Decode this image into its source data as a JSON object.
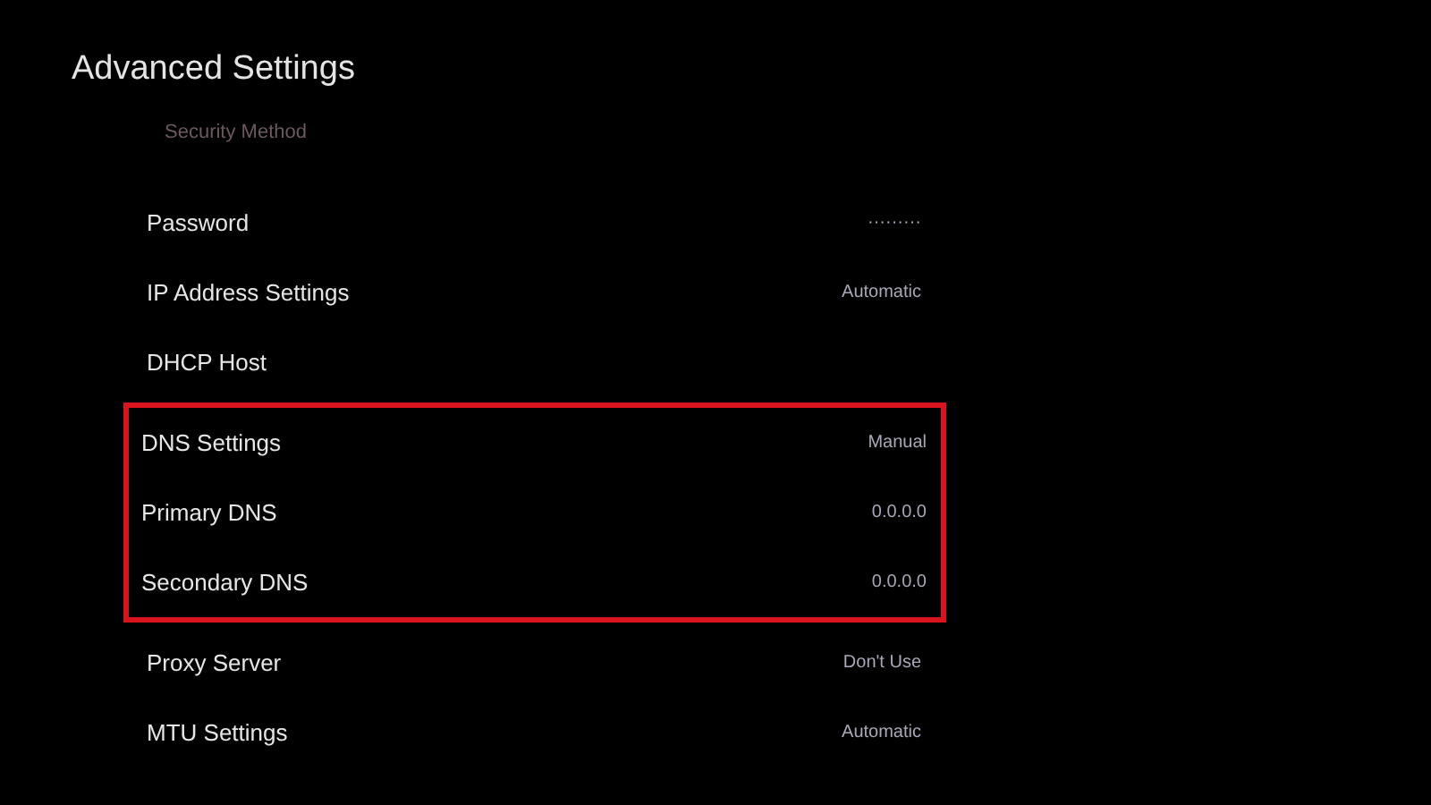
{
  "title": "Advanced Settings",
  "faded_item": "Security Method",
  "rows": [
    {
      "label": "Password",
      "value": "·········",
      "highlighted": false
    },
    {
      "label": "IP Address Settings",
      "value": "Automatic",
      "highlighted": false
    },
    {
      "label": "DHCP Host",
      "highlighted": false
    },
    {
      "label": "DNS Settings",
      "value": "Manual",
      "highlighted": true
    },
    {
      "label": "Primary DNS",
      "value": "0.0.0.0",
      "highlighted": true
    },
    {
      "label": "Secondary DNS",
      "value": "0.0.0.0",
      "highlighted": true
    },
    {
      "label": "Proxy Server",
      "value": "Don't Use",
      "highlighted": false
    },
    {
      "label": "MTU Settings",
      "value": "Automatic",
      "highlighted": false
    }
  ]
}
